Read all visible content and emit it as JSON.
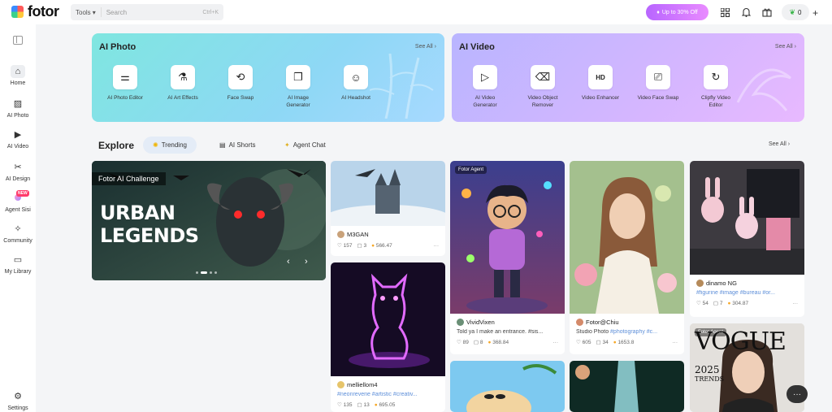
{
  "header": {
    "logo_text": "fotor",
    "tools_label": "Tools",
    "search_placeholder": "Search",
    "search_shortcut": "Ctrl+K",
    "promo_label": "Up to 30% Off",
    "credits_value": "0"
  },
  "sidebar": {
    "items": [
      {
        "label": "Home"
      },
      {
        "label": "AI Photo"
      },
      {
        "label": "AI Video"
      },
      {
        "label": "AI Design"
      },
      {
        "label": "Agent Sisi",
        "badge": "NEW"
      },
      {
        "label": "Community"
      },
      {
        "label": "My Library"
      }
    ],
    "settings_label": "Settings"
  },
  "ai_photo": {
    "title": "AI Photo",
    "see_all": "See All",
    "tiles": [
      {
        "label": "AI Photo Editor"
      },
      {
        "label": "AI Art Effects"
      },
      {
        "label": "Face Swap"
      },
      {
        "label": "AI Image Generator"
      },
      {
        "label": "AI Headshot"
      }
    ]
  },
  "ai_video": {
    "title": "AI Video",
    "see_all": "See All",
    "tiles": [
      {
        "label": "AI Video Generator"
      },
      {
        "label": "Video Object Remover"
      },
      {
        "label": "Video Enhancer"
      },
      {
        "label": "Video Face Swap"
      },
      {
        "label": "Clipfly Video Editor"
      }
    ]
  },
  "explore": {
    "title": "Explore",
    "chips": [
      {
        "label": "Trending"
      },
      {
        "label": "AI Shorts"
      },
      {
        "label": "Agent Chat"
      }
    ],
    "see_all": "See All"
  },
  "hero": {
    "badge": "Fotor AI Challenge",
    "line1": "URBAN",
    "line2": "LEGENDS"
  },
  "cards": {
    "castle": {
      "author": "M3GAN",
      "views": "157",
      "comments": "3",
      "points": "566.47"
    },
    "cat": {
      "author": "melliellom4",
      "tags": "#neonreverie #artistic #creativ...",
      "views": "135",
      "comments": "13",
      "points": "695.05"
    },
    "boy": {
      "badge": "Fotor Agent",
      "author": "VividVixen",
      "caption": "Told ya I make an entrance. #sis...",
      "views": "89",
      "comments": "8",
      "points": "368.84"
    },
    "woman": {
      "author": "Fotor@Chiu",
      "caption_prefix": "Studio Photo ",
      "caption_tags": "#photography #c...",
      "views": "605",
      "comments": "34",
      "points": "1653.8"
    },
    "desk": {
      "author": "dinamo NG",
      "tags": "#figurine #image #bureau #or...",
      "views": "54",
      "comments": "7",
      "points": "304.87"
    },
    "vogue": {
      "badge": "Fotor Agent",
      "magazine": "VOGUE",
      "year": "2025",
      "trends": "TRENDS"
    }
  }
}
